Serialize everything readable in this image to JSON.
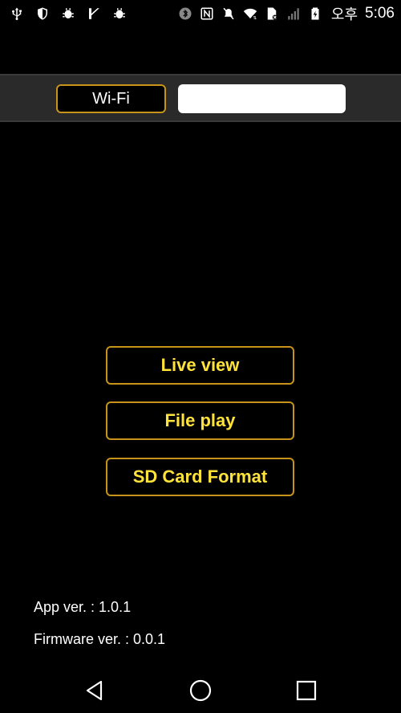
{
  "status_bar": {
    "left_icons": [
      "usb-icon",
      "shield-icon",
      "bug-icon",
      "check-icon",
      "bug-icon"
    ],
    "right_icons": [
      "bluetooth-icon",
      "nfc-icon",
      "mute-icon",
      "wifi-icon",
      "data-off-icon",
      "signal-icon",
      "battery-icon"
    ],
    "ampm": "오후",
    "time": "5:06"
  },
  "wifi": {
    "button_label": "Wi-Fi",
    "ssid_value": ""
  },
  "menu": {
    "live_view": "Live view",
    "file_play": "File play",
    "sd_format": "SD Card Format"
  },
  "footer": {
    "app_version": "App ver. : 1.0.1",
    "firmware_version": "Firmware ver. : 0.0.1"
  },
  "colors": {
    "background": "#000000",
    "accent_border": "#c8931a",
    "button_text": "#ffe23a",
    "bar": "#2a2a2a"
  }
}
